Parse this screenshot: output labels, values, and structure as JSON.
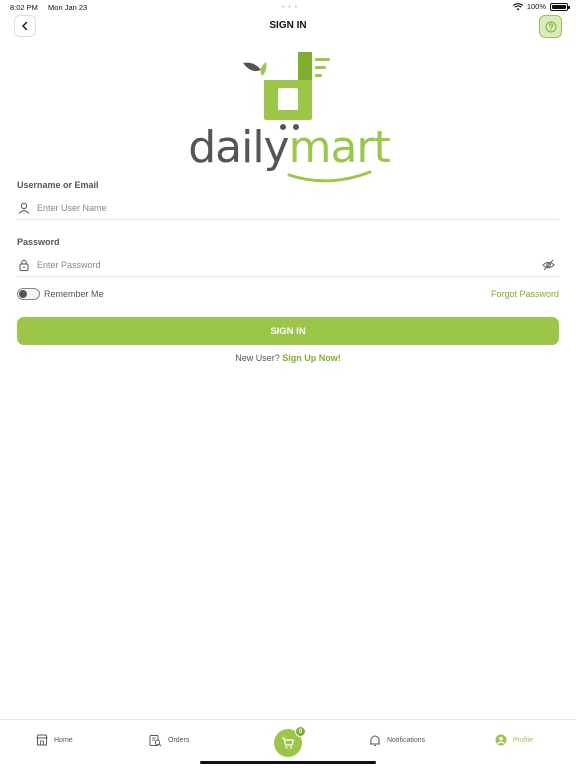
{
  "status_bar": {
    "time": "8:02 PM",
    "date": "Mon Jan 23",
    "battery": "100%",
    "battery_level": 1.0
  },
  "header": {
    "title": "SIGN IN",
    "back_icon": "chevron-left-icon",
    "help_icon": "question-circle-icon"
  },
  "logo": {
    "text_part1": "daily",
    "text_part2": "mart"
  },
  "colors": {
    "brand_green": "#9bc64a",
    "link_green": "#7fae2e",
    "logo_dark": "#555555"
  },
  "form": {
    "username_label": "Username or Email",
    "username_placeholder": "Enter User Name",
    "username_value": "",
    "password_label": "Password",
    "password_placeholder": "Enter Password",
    "password_value": "",
    "remember_label": "Remember Me",
    "remember_checked": false,
    "forgot_label": "Forgot Password",
    "submit_label": "SIGN IN",
    "new_user_text": "New User?",
    "signup_label": "Sign Up Now!"
  },
  "tabs": [
    {
      "label": "Home",
      "icon": "store-icon"
    },
    {
      "label": "Orders",
      "icon": "orders-search-icon"
    },
    {
      "label": "Notifications",
      "icon": "bell-icon"
    },
    {
      "label": "Profile",
      "icon": "user-circle-icon",
      "active": true
    }
  ],
  "cart": {
    "icon": "cart-icon",
    "count": "0"
  }
}
